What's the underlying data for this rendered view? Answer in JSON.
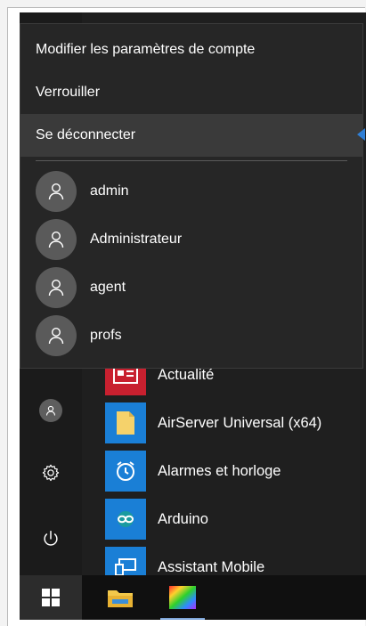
{
  "colors": {
    "menu_bg": "#262626",
    "start_bg": "#1f1f1f",
    "selected_bg": "#3a3a3a",
    "accent_pointer": "#2f7fd6",
    "taskbar_bg": "#101010",
    "tile_red": "#c8202f",
    "tile_blue": "#1a7fd6"
  },
  "account_menu": {
    "actions": [
      {
        "label": "Modifier les paramètres de compte"
      },
      {
        "label": "Verrouiller"
      },
      {
        "label": "Se déconnecter",
        "selected": true
      }
    ],
    "users": [
      {
        "name": "admin",
        "icon": "user-icon"
      },
      {
        "name": "Administrateur",
        "icon": "user-icon"
      },
      {
        "name": "agent",
        "icon": "user-icon"
      },
      {
        "name": "profs",
        "icon": "user-icon"
      }
    ]
  },
  "app_list": [
    {
      "label": "Actualité",
      "icon": "news-icon",
      "tile_color": "#c8202f"
    },
    {
      "label": "AirServer Universal (x64)",
      "icon": "document-icon",
      "tile_color": "#1a7fd6"
    },
    {
      "label": "Alarmes et horloge",
      "icon": "alarm-clock-icon",
      "tile_color": "#1a7fd6"
    },
    {
      "label": "Arduino",
      "icon": "arduino-icon",
      "tile_color": "#1a7fd6"
    },
    {
      "label": "Assistant Mobile",
      "icon": "phone-monitor-icon",
      "tile_color": "#1a7fd6"
    }
  ],
  "left_rail": [
    {
      "icon": "user-avatar-icon"
    },
    {
      "icon": "gear-icon"
    },
    {
      "icon": "power-icon"
    }
  ],
  "taskbar": {
    "items": [
      {
        "icon": "windows-logo-icon"
      },
      {
        "icon": "file-explorer-icon"
      },
      {
        "icon": "color-app-icon"
      }
    ]
  }
}
